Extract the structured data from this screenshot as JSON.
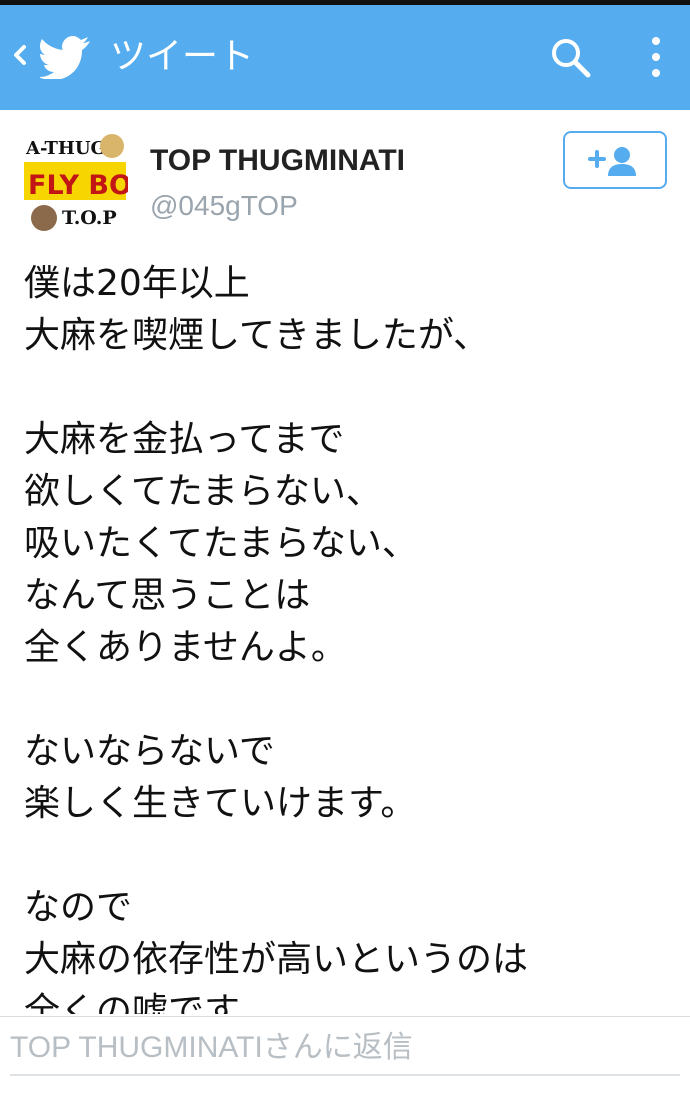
{
  "appbar": {
    "title": "ツイート",
    "background": "#55acee",
    "icons": [
      "chevron-left-icon",
      "twitter-bird-icon",
      "search-icon",
      "more-vert-icon"
    ]
  },
  "tweet": {
    "author_name": "TOP THUGMINATI",
    "author_handle": "@045gTOP",
    "avatar_text": {
      "line1": "A-THUG",
      "line2": "FLY BOY",
      "line3": "T.O.P"
    },
    "follow_icon": "add-user-icon",
    "text": "僕は20年以上\n大麻を喫煙してきましたが、\n\n大麻を金払ってまで\n欲しくてたまらない、\n吸いたくてたまらない、\nなんて思うことは\n全くありませんよ。\n\nないならないで\n楽しく生きていけます。\n\nなので\n大麻の依存性が高いというのは\n全くの嘘です。"
  },
  "reply": {
    "placeholder": "TOP THUGMINATIさんに返信"
  },
  "colors": {
    "accent": "#55acee",
    "text": "#111111",
    "secondary_text": "#9aa4ad",
    "placeholder": "#b7bec4"
  }
}
